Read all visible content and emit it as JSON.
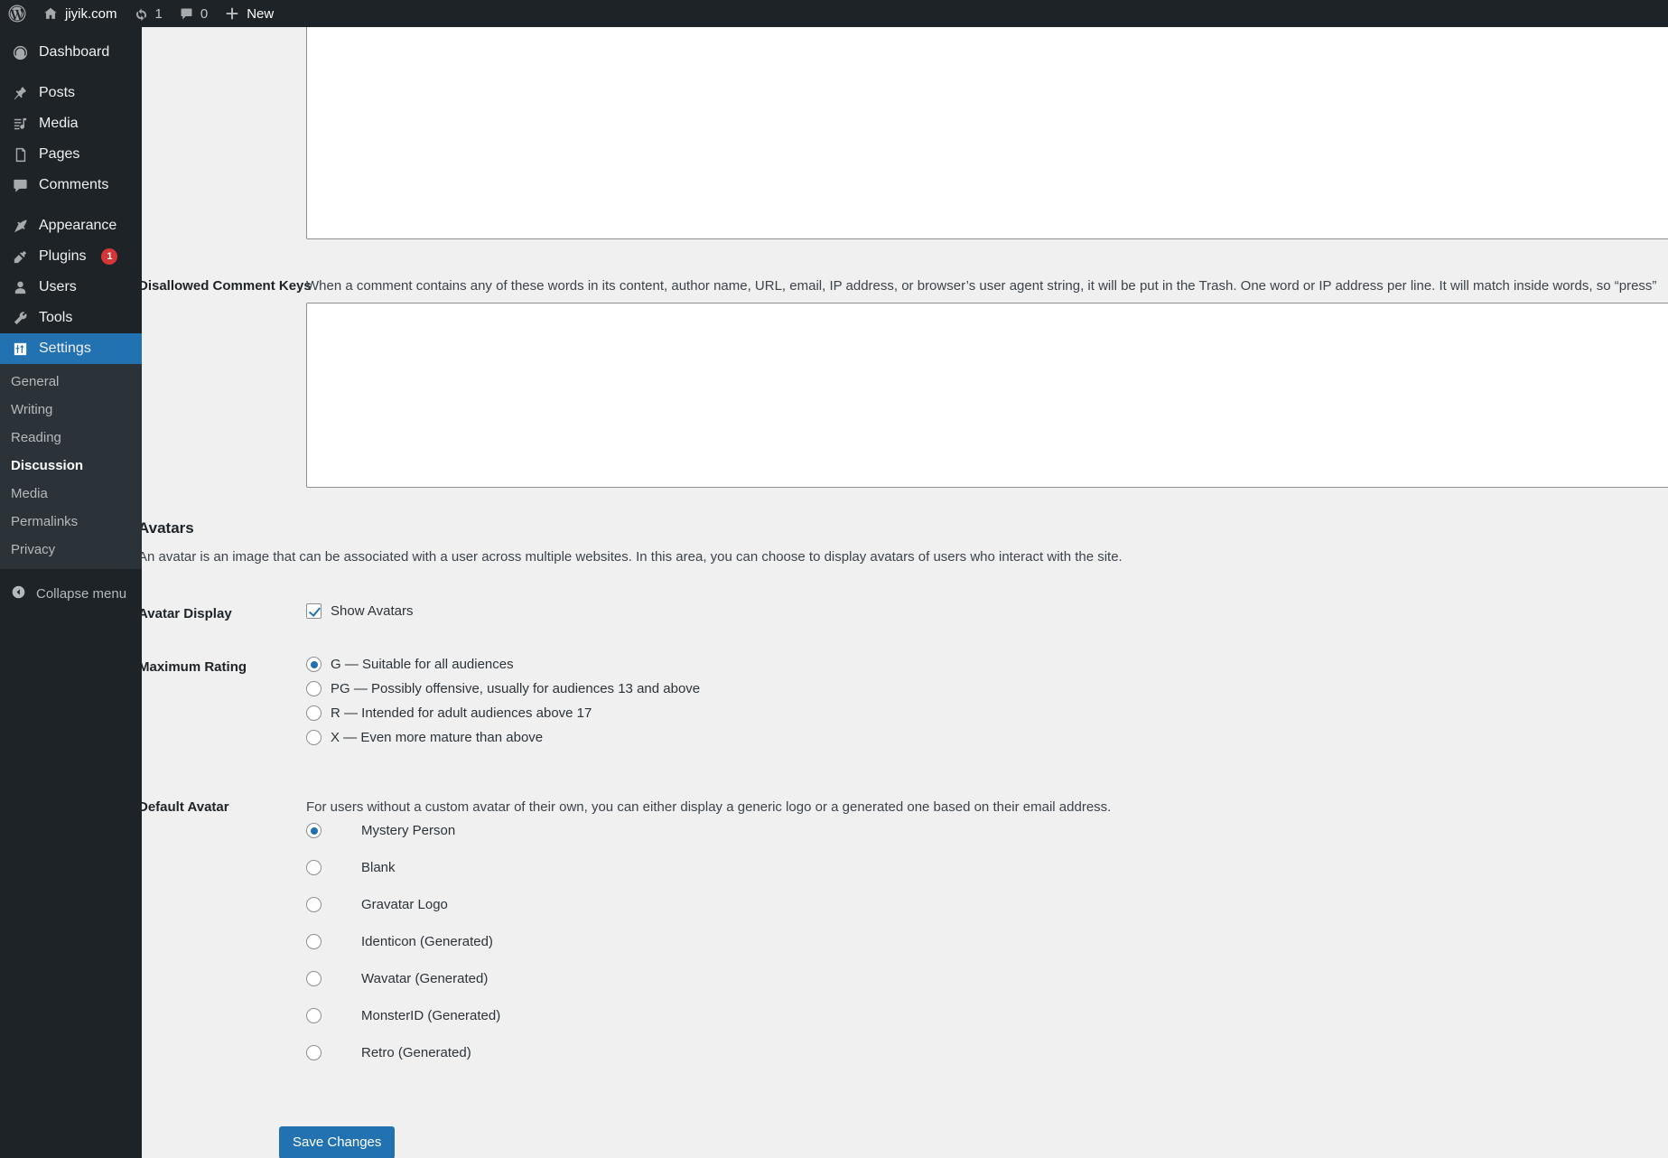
{
  "adminbar": {
    "wp_logo_name": "wordpress-logo-icon",
    "site_name": "jiyik.com",
    "updates_count": "1",
    "comments_count": "0",
    "new_label": "New"
  },
  "sidebar": {
    "items": [
      {
        "label": "Dashboard",
        "icon": "dashboard-icon",
        "separator_after": true
      },
      {
        "label": "Posts",
        "icon": "pin-icon"
      },
      {
        "label": "Media",
        "icon": "media-icon"
      },
      {
        "label": "Pages",
        "icon": "page-icon"
      },
      {
        "label": "Comments",
        "icon": "comment-bubble-icon",
        "separator_after": true
      },
      {
        "label": "Appearance",
        "icon": "paintbrush-icon"
      },
      {
        "label": "Plugins",
        "icon": "plug-icon",
        "badge": "1"
      },
      {
        "label": "Users",
        "icon": "user-icon"
      },
      {
        "label": "Tools",
        "icon": "wrench-icon"
      },
      {
        "label": "Settings",
        "icon": "settings-sliders-icon",
        "current": true
      }
    ],
    "settings_submenu": [
      {
        "label": "General"
      },
      {
        "label": "Writing"
      },
      {
        "label": "Reading"
      },
      {
        "label": "Discussion",
        "current": true
      },
      {
        "label": "Media"
      },
      {
        "label": "Permalinks"
      },
      {
        "label": "Privacy"
      }
    ],
    "collapse_label": "Collapse menu",
    "collapse_icon": "chevron-left-circle-icon"
  },
  "main": {
    "disallowed_comment_keys": {
      "label": "Disallowed Comment Keys",
      "description": "When a comment contains any of these words in its content, author name, URL, email, IP address, or browser’s user agent string, it will be put in the Trash. One word or IP address per line. It will match inside words, so “press”",
      "value": ""
    },
    "moderation_keys": {
      "value": ""
    },
    "avatars": {
      "title": "Avatars",
      "description": "An avatar is an image that can be associated with a user across multiple websites. In this area, you can choose to display avatars of users who interact with the site."
    },
    "avatar_display": {
      "label": "Avatar Display",
      "checkbox_label": "Show Avatars",
      "checked": true
    },
    "maximum_rating": {
      "label": "Maximum Rating",
      "options": [
        {
          "label": "G — Suitable for all audiences",
          "checked": true
        },
        {
          "label": "PG — Possibly offensive, usually for audiences 13 and above",
          "checked": false
        },
        {
          "label": "R — Intended for adult audiences above 17",
          "checked": false
        },
        {
          "label": "X — Even more mature than above",
          "checked": false
        }
      ]
    },
    "default_avatar": {
      "label": "Default Avatar",
      "description": "For users without a custom avatar of their own, you can either display a generic logo or a generated one based on their email address.",
      "options": [
        {
          "label": "Mystery Person",
          "checked": true
        },
        {
          "label": "Blank",
          "checked": false
        },
        {
          "label": "Gravatar Logo",
          "checked": false
        },
        {
          "label": "Identicon (Generated)",
          "checked": false
        },
        {
          "label": "Wavatar (Generated)",
          "checked": false
        },
        {
          "label": "MonsterID (Generated)",
          "checked": false
        },
        {
          "label": "Retro (Generated)",
          "checked": false
        }
      ]
    },
    "submit_label": "Save Changes"
  },
  "colors": {
    "accent": "#2271b1",
    "sidebar_bg": "#1d2327",
    "submenu_bg": "#2c3338",
    "content_bg": "#f0f0f1",
    "badge_red": "#d63638"
  }
}
